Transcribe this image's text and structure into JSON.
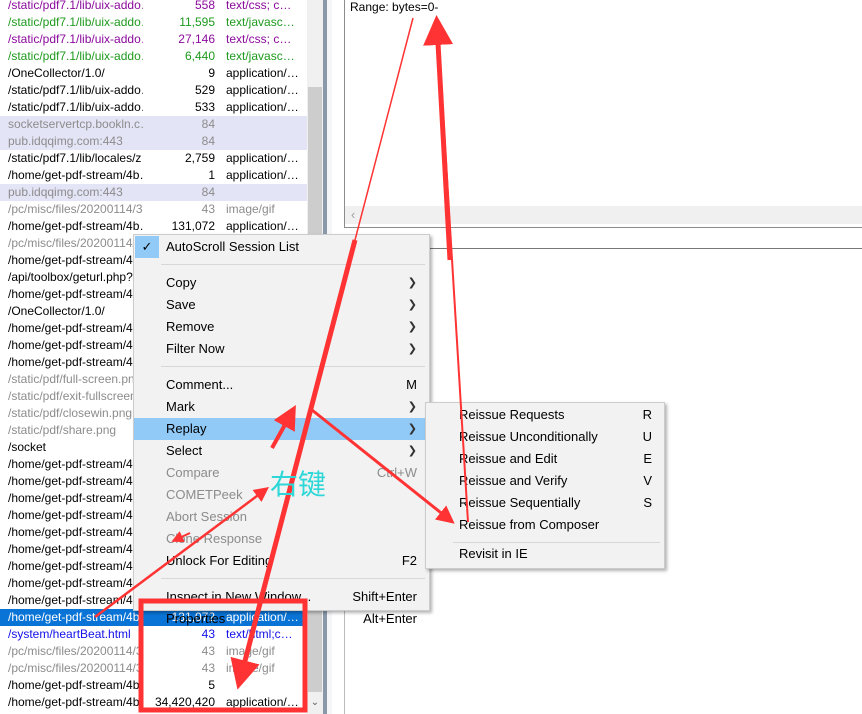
{
  "colors": {
    "purple": "#8b0a9c",
    "green": "#1e9a1e",
    "black": "#000000",
    "gray": "#8c8c8c",
    "blue": "#1010e8",
    "selected": "#0a74d6",
    "annotation": "#ff3333",
    "annotation_text": "#2dd7d7"
  },
  "sessions": [
    {
      "url": "/static/pdf7.1/lib/uix-addo…",
      "size": "558",
      "type": "text/css; c…",
      "color": "purple"
    },
    {
      "url": "/static/pdf7.1/lib/uix-addo…",
      "size": "11,595",
      "type": "text/javasc…",
      "color": "green"
    },
    {
      "url": "/static/pdf7.1/lib/uix-addo…",
      "size": "27,146",
      "type": "text/css; c…",
      "color": "purple"
    },
    {
      "url": "/static/pdf7.1/lib/uix-addo…",
      "size": "6,440",
      "type": "text/javasc…",
      "color": "green"
    },
    {
      "url": "/OneCollector/1.0/",
      "size": "9",
      "type": "application/…",
      "color": "black"
    },
    {
      "url": "/static/pdf7.1/lib/uix-addo…",
      "size": "529",
      "type": "application/…",
      "color": "black"
    },
    {
      "url": "/static/pdf7.1/lib/uix-addo…",
      "size": "533",
      "type": "application/…",
      "color": "black"
    },
    {
      "url": "socketservertcp.bookln.c…",
      "size": "84",
      "type": "",
      "color": "gray",
      "tunnel": true
    },
    {
      "url": "pub.idqqimg.com:443",
      "size": "84",
      "type": "",
      "color": "gray",
      "tunnel": true
    },
    {
      "url": "/static/pdf7.1/lib/locales/z…",
      "size": "2,759",
      "type": "application/…",
      "color": "black"
    },
    {
      "url": "/home/get-pdf-stream/4b…",
      "size": "1",
      "type": "application/…",
      "color": "black"
    },
    {
      "url": "pub.idqqimg.com:443",
      "size": "84",
      "type": "",
      "color": "gray",
      "tunnel": true
    },
    {
      "url": "/pc/misc/files/20200114/3…",
      "size": "43",
      "type": "image/gif",
      "color": "gray"
    },
    {
      "url": "/home/get-pdf-stream/4b…",
      "size": "131,072",
      "type": "application/…",
      "color": "black"
    },
    {
      "url": "/pc/misc/files/20200114/3…",
      "size": "",
      "type": "",
      "color": "gray"
    },
    {
      "url": "/home/get-pdf-stream/4b…",
      "size": "",
      "type": "",
      "color": "black"
    },
    {
      "url": "/api/toolbox/geturl.php?h…",
      "size": "",
      "type": "",
      "color": "black"
    },
    {
      "url": "/home/get-pdf-stream/4b…",
      "size": "",
      "type": "",
      "color": "black"
    },
    {
      "url": "/OneCollector/1.0/",
      "size": "",
      "type": "",
      "color": "black"
    },
    {
      "url": "/home/get-pdf-stream/4b…",
      "size": "",
      "type": "",
      "color": "black"
    },
    {
      "url": "/home/get-pdf-stream/4b…",
      "size": "",
      "type": "",
      "color": "black"
    },
    {
      "url": "/home/get-pdf-stream/4b…",
      "size": "",
      "type": "",
      "color": "black"
    },
    {
      "url": "/static/pdf/full-screen.png",
      "size": "",
      "type": "",
      "color": "gray"
    },
    {
      "url": "/static/pdf/exit-fullscreen…",
      "size": "",
      "type": "",
      "color": "gray"
    },
    {
      "url": "/static/pdf/closewin.png",
      "size": "",
      "type": "",
      "color": "gray"
    },
    {
      "url": "/static/pdf/share.png",
      "size": "",
      "type": "",
      "color": "gray"
    },
    {
      "url": "/socket",
      "size": "",
      "type": "",
      "color": "black"
    },
    {
      "url": "/home/get-pdf-stream/4b…",
      "size": "",
      "type": "",
      "color": "black"
    },
    {
      "url": "/home/get-pdf-stream/4b…",
      "size": "",
      "type": "",
      "color": "black"
    },
    {
      "url": "/home/get-pdf-stream/4b…",
      "size": "",
      "type": "",
      "color": "black"
    },
    {
      "url": "/home/get-pdf-stream/4b…",
      "size": "",
      "type": "",
      "color": "black"
    },
    {
      "url": "/home/get-pdf-stream/4b…",
      "size": "",
      "type": "",
      "color": "black"
    },
    {
      "url": "/home/get-pdf-stream/4b…",
      "size": "",
      "type": "",
      "color": "black"
    },
    {
      "url": "/home/get-pdf-stream/4b…",
      "size": "",
      "type": "",
      "color": "black"
    },
    {
      "url": "/home/get-pdf-stream/4b…",
      "size": "",
      "type": "",
      "color": "black"
    },
    {
      "url": "/home/get-pdf-stream/4b…",
      "size": "",
      "type": "",
      "color": "black"
    },
    {
      "url": "/home/get-pdf-stream/4b…",
      "size": "131,072",
      "type": "application/…",
      "color": "black",
      "selected": true
    },
    {
      "url": "/system/heartBeat.html",
      "size": "43",
      "type": "text/html;c…",
      "color": "blue"
    },
    {
      "url": "/pc/misc/files/20200114/3…",
      "size": "43",
      "type": "image/gif",
      "color": "gray"
    },
    {
      "url": "/pc/misc/files/20200114/3…",
      "size": "43",
      "type": "image/gif",
      "color": "gray"
    },
    {
      "url": "/home/get-pdf-stream/4b…",
      "size": "5",
      "type": "",
      "color": "black"
    },
    {
      "url": "/home/get-pdf-stream/4b…",
      "size": "34,420,420",
      "type": "application/…",
      "color": "black"
    }
  ],
  "inspector": {
    "raw_text": "Range: bytes=0-"
  },
  "context_menu": {
    "items": [
      {
        "label": "AutoScroll Session List",
        "checked": true
      },
      {
        "sep": true
      },
      {
        "label": "Copy",
        "submenu": true
      },
      {
        "label": "Save",
        "submenu": true
      },
      {
        "label": "Remove",
        "submenu": true
      },
      {
        "label": "Filter Now",
        "submenu": true
      },
      {
        "sep": true
      },
      {
        "label": "Comment...",
        "shortcut": "M"
      },
      {
        "label": "Mark",
        "submenu": true
      },
      {
        "label": "Replay",
        "submenu": true,
        "highlighted": true
      },
      {
        "label": "Select",
        "submenu": true
      },
      {
        "label": "Compare",
        "shortcut": "Ctrl+W",
        "disabled": true
      },
      {
        "label": "COMETPeek",
        "disabled": true
      },
      {
        "label": "Abort Session",
        "disabled": true
      },
      {
        "label": "Clone Response",
        "disabled": true
      },
      {
        "label": "Unlock For Editing",
        "shortcut": "F2"
      },
      {
        "sep": true
      },
      {
        "label": "Inspect in New Window...",
        "shortcut": "Shift+Enter"
      },
      {
        "label": "Properties",
        "shortcut": "Alt+Enter"
      }
    ]
  },
  "replay_submenu": {
    "items": [
      {
        "label": "Reissue Requests",
        "shortcut": "R"
      },
      {
        "label": "Reissue Unconditionally",
        "shortcut": "U"
      },
      {
        "label": "Reissue and Edit",
        "shortcut": "E"
      },
      {
        "label": "Reissue and Verify",
        "shortcut": "V"
      },
      {
        "label": "Reissue Sequentially",
        "shortcut": "S"
      },
      {
        "label": "Reissue from Composer"
      },
      {
        "sep": true
      },
      {
        "label": "Revisit in IE"
      }
    ]
  },
  "annotation": {
    "label": "右键"
  }
}
